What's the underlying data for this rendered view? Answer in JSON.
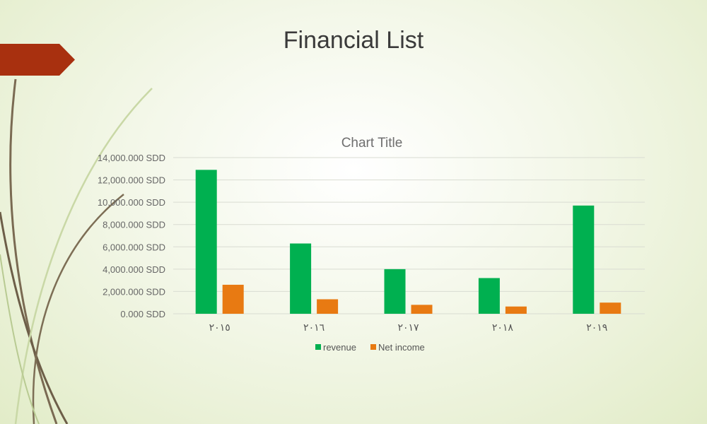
{
  "slide": {
    "title": "Financial List",
    "accent_color": "#a8300f"
  },
  "chart_data": {
    "type": "bar",
    "title": "Chart Title",
    "categories": [
      "٢٠١٥",
      "٢٠١٦",
      "٢٠١٧",
      "٢٠١٨",
      "٢٠١٩"
    ],
    "series": [
      {
        "name": "revenue",
        "color": "#00b050",
        "values": [
          12900000,
          6300000,
          4000000,
          3200000,
          9700000
        ]
      },
      {
        "name": "Net income",
        "color": "#e87a12",
        "values": [
          2600000,
          1300000,
          800000,
          650000,
          1000000
        ]
      }
    ],
    "ylim": [
      0,
      14000000
    ],
    "yticks": [
      0,
      2000000,
      4000000,
      6000000,
      8000000,
      10000000,
      12000000,
      14000000
    ],
    "ytick_labels": [
      "0.000 SDD",
      "2,000.000 SDD",
      "4,000.000 SDD",
      "6,000.000 SDD",
      "8,000.000 SDD",
      "10,000.000 SDD",
      "12,000.000 SDD",
      "14,000.000 SDD"
    ],
    "grid": true,
    "legend": "bottom"
  }
}
